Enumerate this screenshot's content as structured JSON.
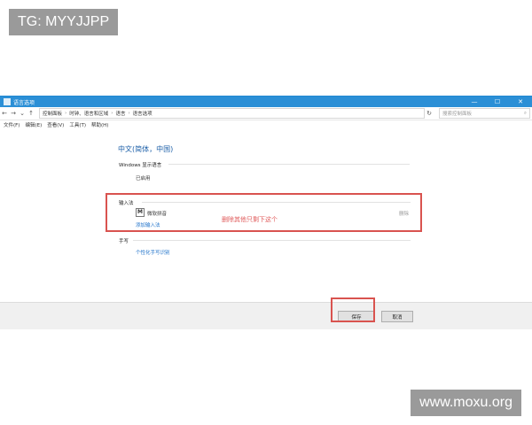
{
  "watermarks": {
    "top": "TG: MYYJJPP",
    "bottom": "www.moxu.org"
  },
  "window": {
    "title": "语言选项",
    "controls": {
      "minimize": "—",
      "maximize": "☐",
      "close": "✕"
    }
  },
  "address": {
    "back": "←",
    "forward": "→",
    "recent": "⌄",
    "up": "↑",
    "crumbs": [
      "控制面板",
      "时钟、语言和区域",
      "语言",
      "语言选项"
    ],
    "refresh": "↻",
    "search_placeholder": "搜索控制面板",
    "search_icon": "⌕"
  },
  "menu": [
    "文件(F)",
    "编辑(E)",
    "查看(V)",
    "工具(T)",
    "帮助(H)"
  ],
  "main": {
    "language_title": "中文(简体，中国)",
    "display_section": "Windows 显示语言",
    "display_status": "已启用",
    "ime_section": "输入法",
    "ime_icon": "M",
    "ime_name": "微软拼音",
    "ime_remove": "删除",
    "add_ime": "添加输入法",
    "handwriting_section": "手写",
    "personalize_handwriting": "个性化手写识别"
  },
  "annotation": {
    "text": "删除其他只剩下这个",
    "color": "#d9534f"
  },
  "buttons": {
    "save": "保存",
    "cancel": "取消"
  }
}
